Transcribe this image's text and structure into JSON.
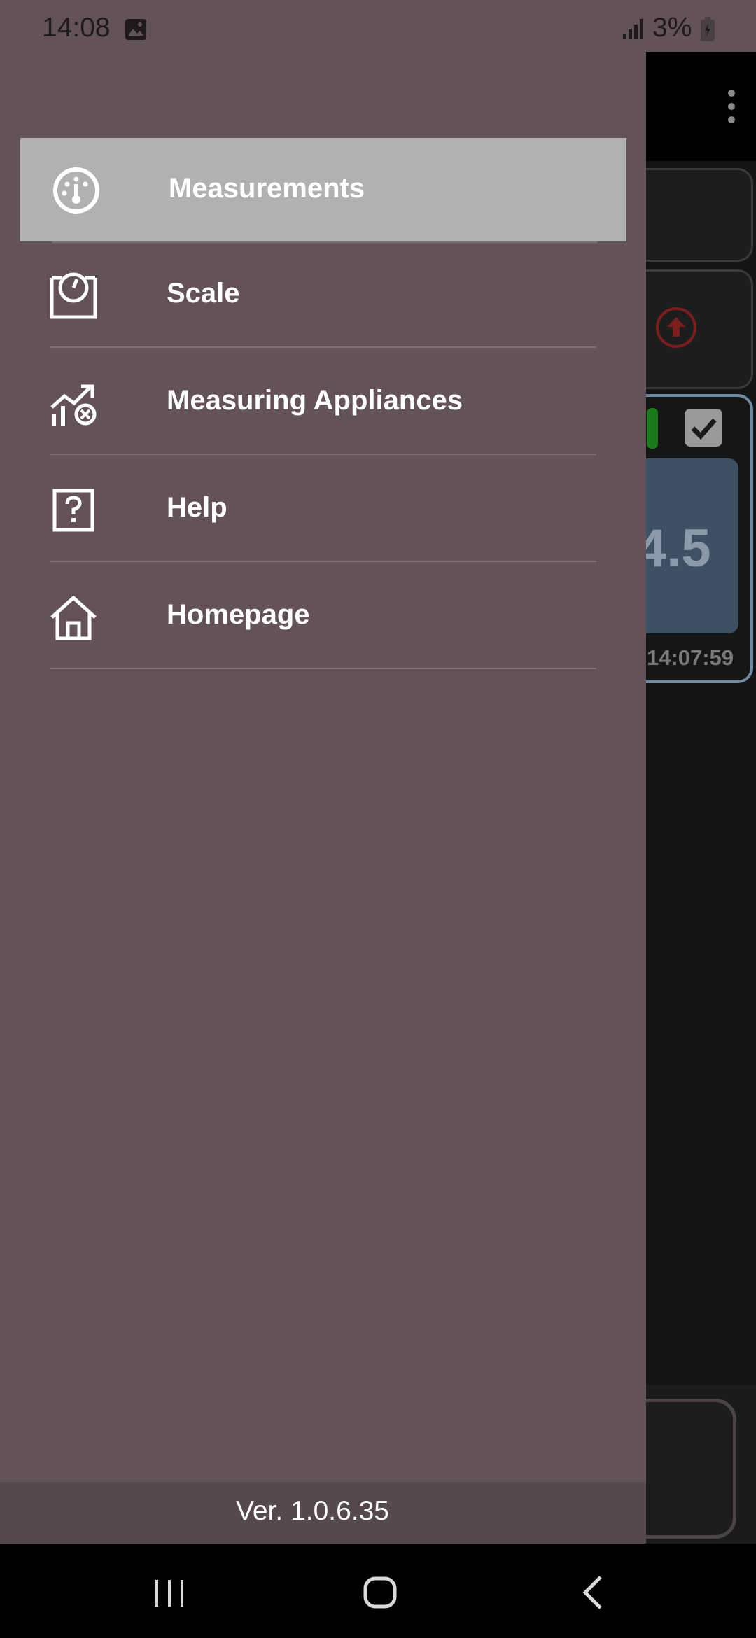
{
  "status_bar": {
    "time": "14:08",
    "battery": "3%",
    "icons": [
      "gallery-icon",
      "signal-icon",
      "battery-icon"
    ]
  },
  "background_app": {
    "reading_value": "4.5",
    "reading_time": "14:07:59"
  },
  "drawer": {
    "items": [
      {
        "label": "Measurements",
        "icon": "gauge-icon",
        "active": true
      },
      {
        "label": "Scale",
        "icon": "scale-icon",
        "active": false
      },
      {
        "label": "Measuring Appliances",
        "icon": "appliances-chart-icon",
        "active": false
      },
      {
        "label": "Help",
        "icon": "help-icon",
        "active": false
      },
      {
        "label": "Homepage",
        "icon": "home-icon",
        "active": false
      }
    ],
    "version": "Ver. 1.0.6.35"
  },
  "colors": {
    "drawer_bg": "#635359",
    "active_item_bg": "#b1b1b1",
    "version_bar_bg": "#55484e",
    "text": "#ffffff"
  },
  "system_nav": {
    "buttons": [
      "recent-apps-icon",
      "home-button-icon",
      "back-icon"
    ]
  }
}
